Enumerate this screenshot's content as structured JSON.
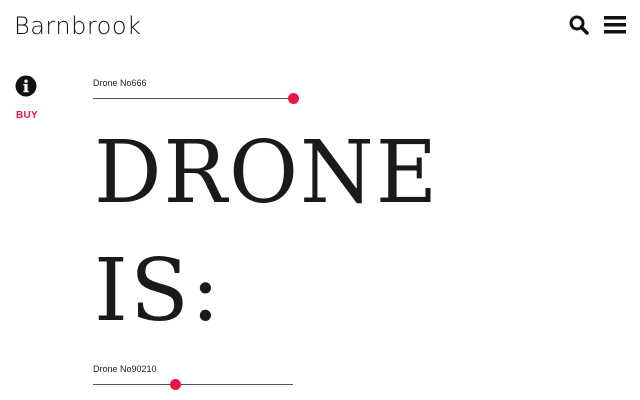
{
  "header": {
    "logo_text": "Barnbrook",
    "search_icon": "search-icon",
    "menu_icon": "hamburger-menu-icon"
  },
  "sidebar": {
    "info_icon": "info-icon",
    "buy_label": "BUY"
  },
  "font_controls": {
    "top_slider": {
      "label": "Drone No666",
      "value_fraction": 1.0
    },
    "bottom_slider": {
      "label": "Drone No90210",
      "value_fraction": 0.41
    }
  },
  "specimen": {
    "line1": "DRONE",
    "line2": "IS:"
  },
  "colors": {
    "accent": "#e8173f",
    "text": "#111111",
    "background": "#ffffff"
  }
}
